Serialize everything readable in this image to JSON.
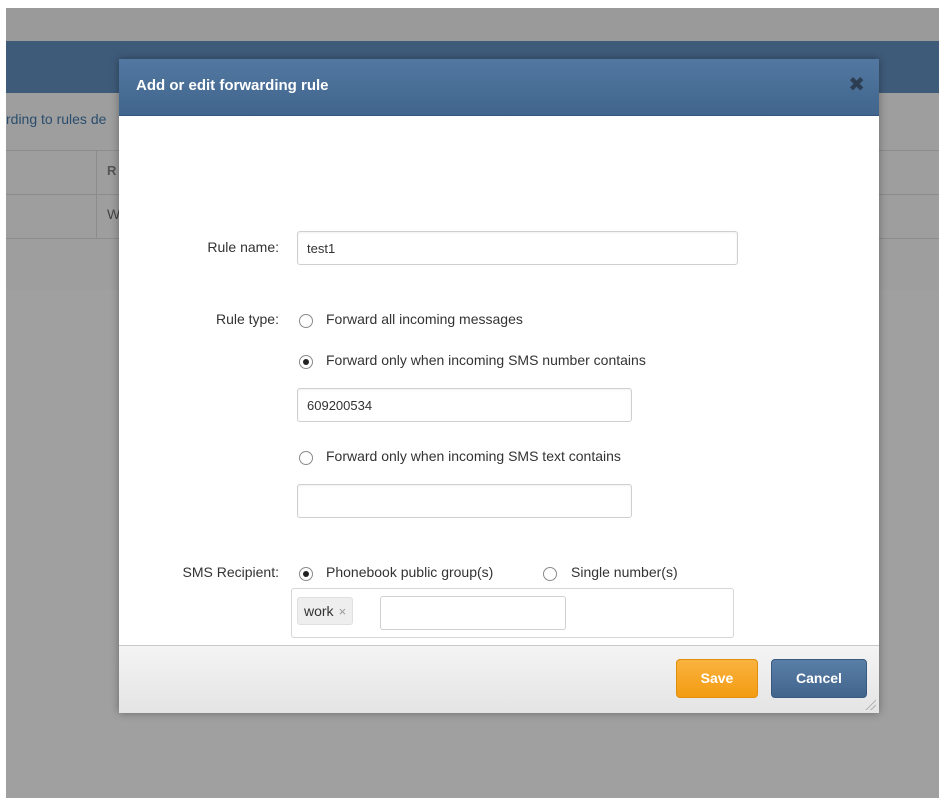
{
  "background": {
    "intro_text": "rding to rules de",
    "table_header_cell": "R",
    "table_cell": "W"
  },
  "modal": {
    "title": "Add or edit forwarding rule",
    "close_icon": "close-icon",
    "rule_name": {
      "label": "Rule name:",
      "value": "test1"
    },
    "rule_type": {
      "label": "Rule type:",
      "options": [
        {
          "label": "Forward all incoming messages",
          "checked": false
        },
        {
          "label": "Forward only when incoming SMS number contains",
          "checked": true
        },
        {
          "label": "Forward only when incoming SMS text contains",
          "checked": false
        }
      ],
      "number_contains_value": "609200534",
      "text_contains_value": ""
    },
    "sms_recipient": {
      "label": "SMS Recipient:",
      "options": [
        {
          "label": "Phonebook public group(s)",
          "checked": true
        },
        {
          "label": "Single number(s)",
          "checked": false
        }
      ],
      "tags": [
        {
          "label": "work",
          "remove_symbol": "×"
        }
      ],
      "tag_input_value": ""
    },
    "footer": {
      "save_label": "Save",
      "cancel_label": "Cancel"
    }
  },
  "colors": {
    "header_blue": "#4a6f96",
    "save_orange": "#f5a623",
    "cancel_blue": "#4a6f96"
  }
}
